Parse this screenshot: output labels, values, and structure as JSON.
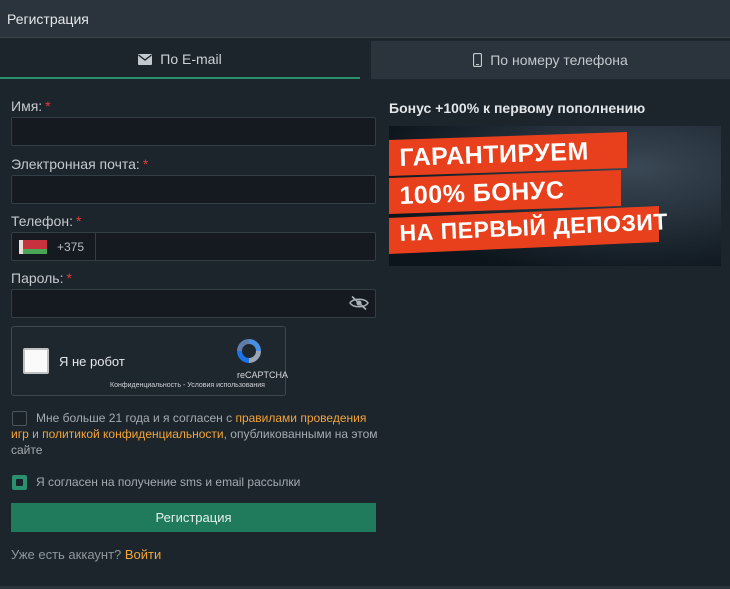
{
  "header": {
    "title": "Регистрация"
  },
  "tabs": [
    {
      "label": "По E-mail",
      "icon": "envelope-icon",
      "active": true
    },
    {
      "label": "По номеру телефона",
      "icon": "phone-icon",
      "active": false
    }
  ],
  "form": {
    "name": {
      "label": "Имя:",
      "required": "*",
      "value": ""
    },
    "email": {
      "label": "Электронная почта:",
      "required": "*",
      "value": ""
    },
    "phone": {
      "label": "Телефон:",
      "required": "*",
      "country_code": "+375",
      "value": ""
    },
    "password": {
      "label": "Пароль:",
      "required": "*",
      "value": ""
    }
  },
  "captcha": {
    "checkbox_label": "Я не робот",
    "brand": "reCAPTCHA",
    "links": "Конфиденциальность - Условия использования"
  },
  "terms": {
    "text_1": "Мне больше 21 года и я согласен с ",
    "link_rules": "правилами проведения игр",
    "text_2": " и ",
    "link_privacy": "политикой конфиденциальности",
    "text_3": ", опубликованными на этом сайте",
    "checked": false
  },
  "sms": {
    "label": "Я согласен на получение sms и email рассылки",
    "checked": true
  },
  "submit_label": "Регистрация",
  "login": {
    "text": "Уже есть аккаунт? ",
    "link": "Войти"
  },
  "bonus": {
    "title": "Бонус +100% к первому пополнению",
    "banner_lines": [
      "ГАРАНТИРУЕМ",
      "100% БОНУС",
      "НА ПЕРВЫЙ ДЕПОЗИТ"
    ]
  },
  "colors": {
    "accent": "#2a9070",
    "link": "#f2a43a",
    "required": "#e23b3b",
    "banner_red": "#e8401c"
  }
}
